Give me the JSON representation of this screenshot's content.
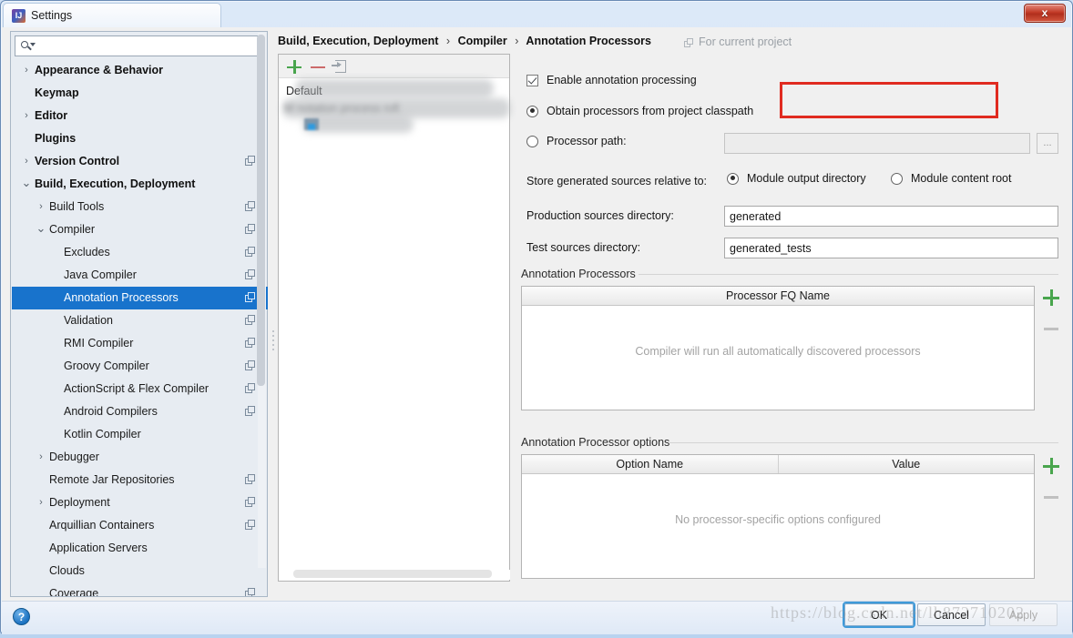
{
  "window": {
    "title": "Settings",
    "app_icon": "intellij-idea-icon",
    "close_label": "x"
  },
  "sidebar": {
    "search": {
      "value": "",
      "placeholder": ""
    },
    "items": [
      {
        "label": "Appearance & Behavior",
        "indent": 0,
        "arrow": "collapsed",
        "bold": true,
        "scope": false,
        "selected": false
      },
      {
        "label": "Keymap",
        "indent": 0,
        "arrow": "none",
        "bold": true,
        "scope": false,
        "selected": false
      },
      {
        "label": "Editor",
        "indent": 0,
        "arrow": "collapsed",
        "bold": true,
        "scope": false,
        "selected": false
      },
      {
        "label": "Plugins",
        "indent": 0,
        "arrow": "none",
        "bold": true,
        "scope": false,
        "selected": false
      },
      {
        "label": "Version Control",
        "indent": 0,
        "arrow": "collapsed",
        "bold": true,
        "scope": true,
        "selected": false
      },
      {
        "label": "Build, Execution, Deployment",
        "indent": 0,
        "arrow": "expanded",
        "bold": true,
        "scope": false,
        "selected": false
      },
      {
        "label": "Build Tools",
        "indent": 1,
        "arrow": "collapsed",
        "bold": false,
        "scope": true,
        "selected": false
      },
      {
        "label": "Compiler",
        "indent": 1,
        "arrow": "expanded",
        "bold": false,
        "scope": true,
        "selected": false
      },
      {
        "label": "Excludes",
        "indent": 2,
        "arrow": "none",
        "bold": false,
        "scope": true,
        "selected": false
      },
      {
        "label": "Java Compiler",
        "indent": 2,
        "arrow": "none",
        "bold": false,
        "scope": true,
        "selected": false
      },
      {
        "label": "Annotation Processors",
        "indent": 2,
        "arrow": "none",
        "bold": false,
        "scope": true,
        "selected": true
      },
      {
        "label": "Validation",
        "indent": 2,
        "arrow": "none",
        "bold": false,
        "scope": true,
        "selected": false
      },
      {
        "label": "RMI Compiler",
        "indent": 2,
        "arrow": "none",
        "bold": false,
        "scope": true,
        "selected": false
      },
      {
        "label": "Groovy Compiler",
        "indent": 2,
        "arrow": "none",
        "bold": false,
        "scope": true,
        "selected": false
      },
      {
        "label": "ActionScript & Flex Compiler",
        "indent": 2,
        "arrow": "none",
        "bold": false,
        "scope": true,
        "selected": false
      },
      {
        "label": "Android Compilers",
        "indent": 2,
        "arrow": "none",
        "bold": false,
        "scope": true,
        "selected": false
      },
      {
        "label": "Kotlin Compiler",
        "indent": 2,
        "arrow": "none",
        "bold": false,
        "scope": false,
        "selected": false
      },
      {
        "label": "Debugger",
        "indent": 1,
        "arrow": "collapsed",
        "bold": false,
        "scope": false,
        "selected": false
      },
      {
        "label": "Remote Jar Repositories",
        "indent": 1,
        "arrow": "none",
        "bold": false,
        "scope": true,
        "selected": false
      },
      {
        "label": "Deployment",
        "indent": 1,
        "arrow": "collapsed",
        "bold": false,
        "scope": true,
        "selected": false
      },
      {
        "label": "Arquillian Containers",
        "indent": 1,
        "arrow": "none",
        "bold": false,
        "scope": true,
        "selected": false
      },
      {
        "label": "Application Servers",
        "indent": 1,
        "arrow": "none",
        "bold": false,
        "scope": false,
        "selected": false
      },
      {
        "label": "Clouds",
        "indent": 1,
        "arrow": "none",
        "bold": false,
        "scope": false,
        "selected": false
      },
      {
        "label": "Coverage",
        "indent": 1,
        "arrow": "none",
        "bold": false,
        "scope": true,
        "selected": false
      }
    ]
  },
  "main": {
    "breadcrumb": {
      "part1": "Build, Execution, Deployment",
      "part2": "Compiler",
      "part3": "Annotation Processors",
      "separator": "›"
    },
    "for_current_project": "For current project",
    "module_panel": {
      "toolbar": {
        "add": "add-module",
        "remove": "remove-module",
        "move_to": "move-to-profile"
      },
      "default_profile": "Default",
      "redacted_row": "M          notation  process            rofi"
    },
    "enable_annotation_processing": {
      "label": "Enable annotation processing",
      "checked": true
    },
    "processor_source": {
      "option_classpath": "Obtain processors from project classpath",
      "option_path": "Processor path:",
      "selected": "classpath",
      "path_value": "",
      "browse_label": "..."
    },
    "store_generated": {
      "label": "Store generated sources relative to:",
      "option_output": "Module output directory",
      "option_content": "Module content root",
      "selected": "output"
    },
    "production_sources": {
      "label": "Production sources directory:",
      "value": "generated"
    },
    "test_sources": {
      "label": "Test sources directory:",
      "value": "generated_tests"
    },
    "annotation_processors": {
      "group_title": "Annotation Processors",
      "column": "Processor FQ Name",
      "empty_message": "Compiler will run all automatically discovered processors",
      "add": "add-processor",
      "remove": "remove-processor"
    },
    "processor_options": {
      "group_title": "Annotation Processor options",
      "column_name": "Option Name",
      "column_value": "Value",
      "empty_message": "No processor-specific options configured",
      "add": "add-option",
      "remove": "remove-option"
    }
  },
  "footer": {
    "help": "?",
    "ok": "OK",
    "cancel": "Cancel",
    "apply": "Apply"
  },
  "watermark": "https://blog.csdn.net/lh872710202",
  "colors": {
    "selection": "#1873cc",
    "highlight_box": "#e02b20",
    "add_green": "#49a54d",
    "remove_red": "#cc6a6a",
    "muted_text": "#a3a3a3"
  }
}
